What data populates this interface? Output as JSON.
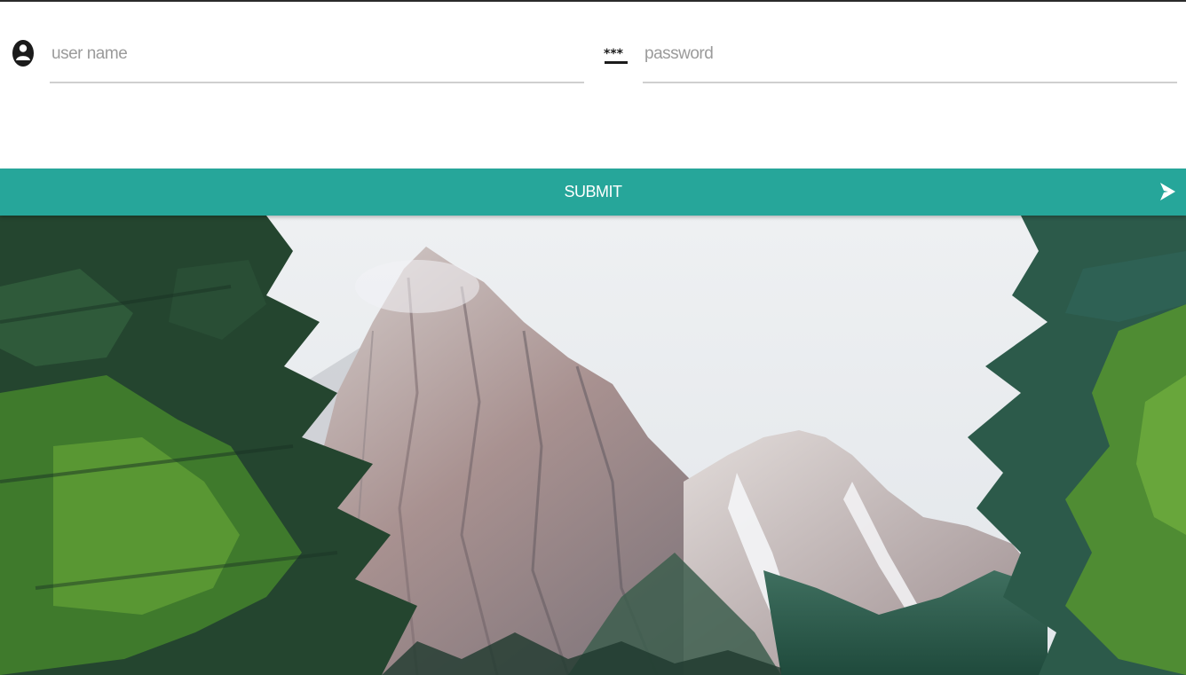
{
  "login_form": {
    "username": {
      "icon": "account-circle-icon",
      "placeholder": "user name",
      "value": ""
    },
    "password": {
      "icon": "password-dots-icon",
      "placeholder": "password",
      "value": ""
    },
    "submit": {
      "label": "SUBMIT",
      "icon": "send-arrow-icon"
    }
  },
  "theme": {
    "accent": "#26a69a",
    "underline": "#cfcfcf",
    "background": "#ffffff"
  },
  "hero_image": {
    "subject": "mountain-landscape-image"
  }
}
